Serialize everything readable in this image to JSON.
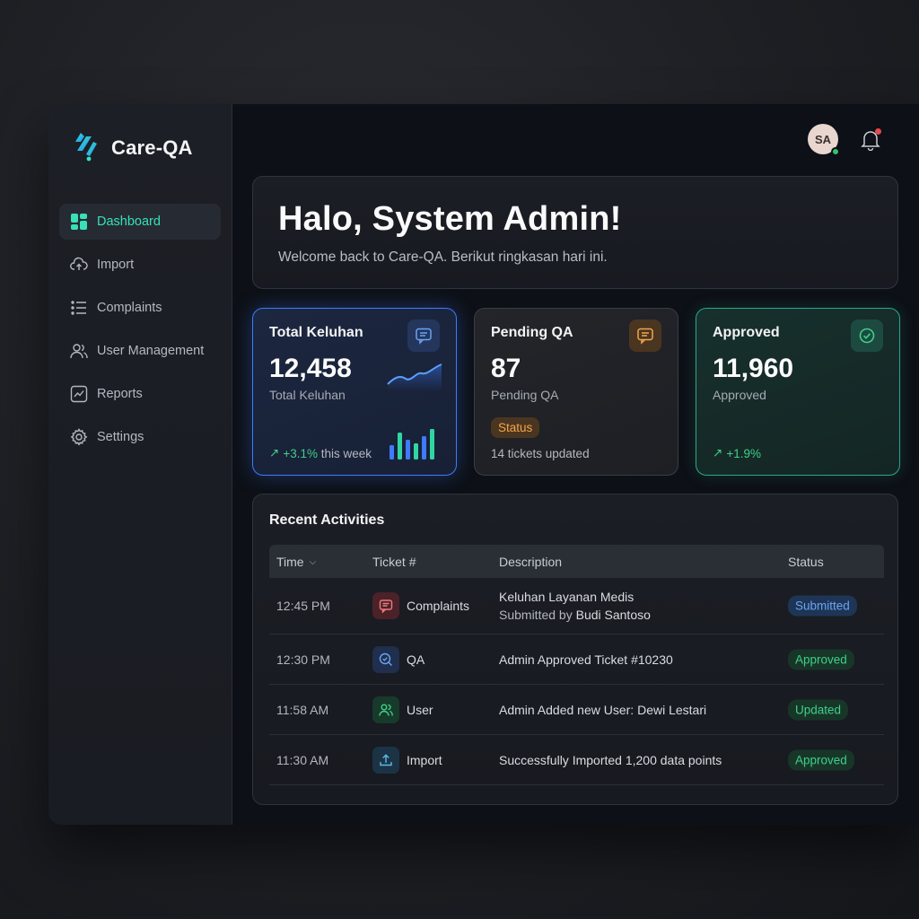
{
  "brand": {
    "name": "Care-QA"
  },
  "sidebar": {
    "items": [
      {
        "label": "Dashboard",
        "icon": "grid-icon",
        "active": true
      },
      {
        "label": "Import",
        "icon": "cloud-upload-icon",
        "active": false
      },
      {
        "label": "Complaints",
        "icon": "list-icon",
        "active": false
      },
      {
        "label": "User Management",
        "icon": "users-icon",
        "active": false
      },
      {
        "label": "Reports",
        "icon": "chart-icon",
        "active": false
      },
      {
        "label": "Settings",
        "icon": "gear-icon",
        "active": false
      }
    ]
  },
  "header": {
    "avatar_initials": "SA"
  },
  "welcome": {
    "title": "Halo, System Admin!",
    "subtitle": "Welcome back to Care-QA. Berikut ringkasan hari ini."
  },
  "cards": [
    {
      "title": "Total Keluhan",
      "value": "12,458",
      "sub": "Total Keluhan",
      "foot": "+3.1%",
      "foot_suffix": " this week",
      "accent": "#3d7bff"
    },
    {
      "title": "Pending QA",
      "value": "87",
      "sub": "Pending QA",
      "chip": "Status",
      "foot": "14 tickets updated",
      "accent": "#f3a64a"
    },
    {
      "title": "Approved",
      "value": "11,960",
      "sub": "Approved",
      "foot": "+1.9%",
      "accent": "#2aa88a"
    }
  ],
  "activities": {
    "title": "Recent Activities",
    "columns": {
      "time": "Time",
      "ticket": "Ticket #",
      "description": "Description",
      "status": "Status"
    },
    "rows": [
      {
        "time": "12:45 PM",
        "ticket": "Complaints",
        "desc": "Keluhan Layanan Medis",
        "desc2_prefix": "Submitted by ",
        "desc2_name": "Budi Santoso",
        "status": "Submitted"
      },
      {
        "time": "12:30 PM",
        "ticket": "QA",
        "desc": "Admin Approved Ticket #10230",
        "status": "Approved"
      },
      {
        "time": "11:58 AM",
        "ticket": "User",
        "desc": "Admin Added new User: Dewi Lestari",
        "status": "Updated"
      },
      {
        "time": "11:30 AM",
        "ticket": "Import",
        "desc": "Successfully Imported 1,200 data points",
        "status": "Approved"
      }
    ]
  }
}
